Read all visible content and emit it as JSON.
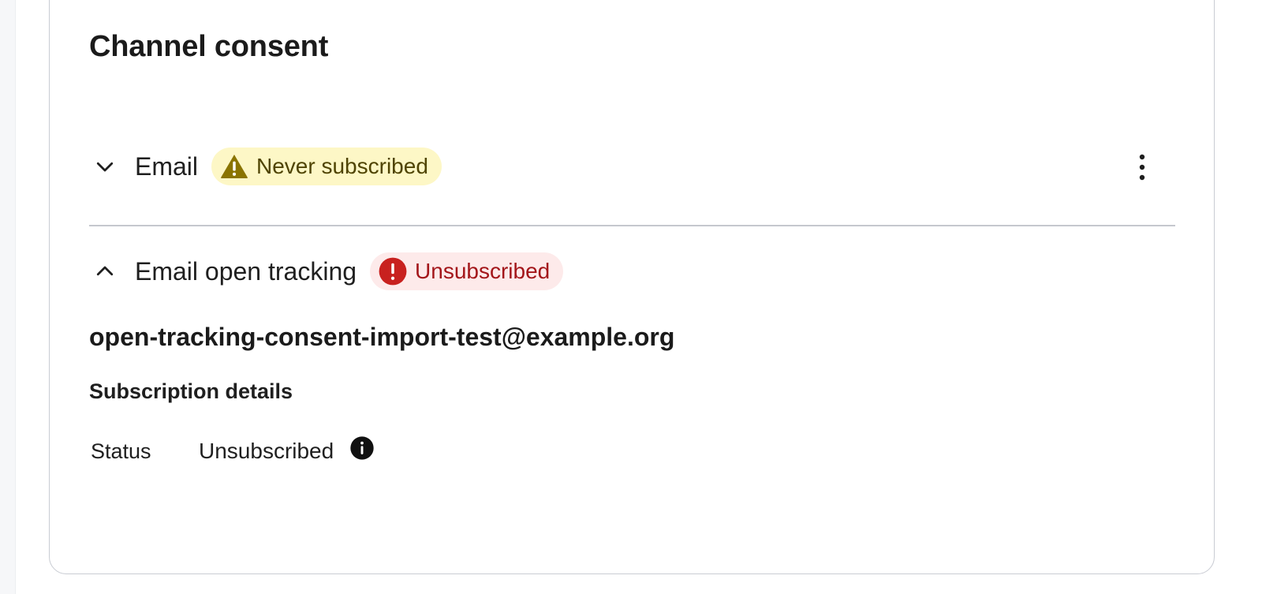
{
  "card": {
    "title": "Channel consent"
  },
  "channels": [
    {
      "label": "Email",
      "expanded": false,
      "status_badge": {
        "text": "Never subscribed",
        "icon": "warning-icon",
        "tone": "warning",
        "background": "#fdf7c6",
        "color": "#4f4402",
        "icon_color": "#8a7400"
      },
      "more_actions_icon": "kebab-menu-icon"
    },
    {
      "label": "Email open tracking",
      "expanded": true,
      "status_badge": {
        "text": "Unsubscribed",
        "icon": "error-icon",
        "tone": "danger",
        "background": "#fdeaea",
        "color": "#a3161a",
        "icon_color": "#c8211f"
      },
      "details": {
        "address": "open-tracking-consent-import-test@example.org",
        "section_heading": "Subscription details",
        "status_label": "Status",
        "status_value": "Unsubscribed",
        "status_info_icon": "info-icon"
      }
    }
  ]
}
